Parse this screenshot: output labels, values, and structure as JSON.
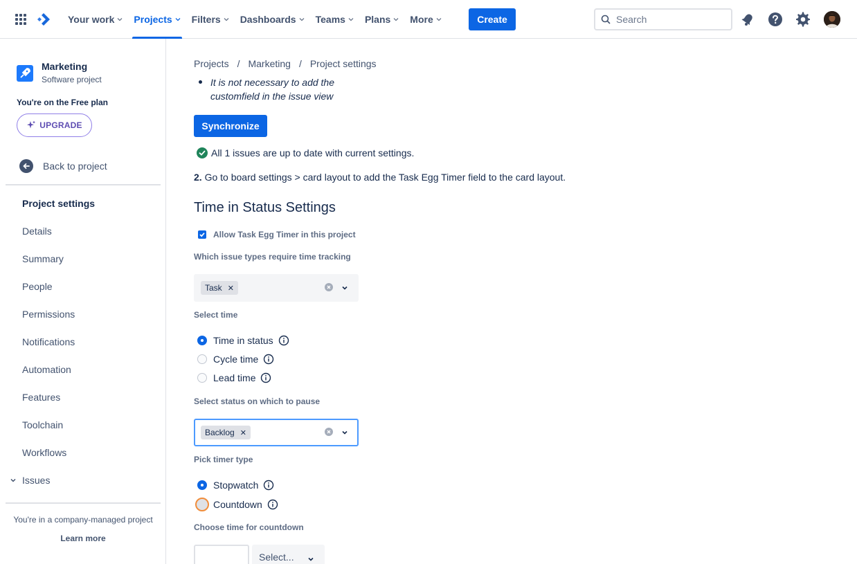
{
  "topnav": {
    "items": [
      {
        "label": "Your work"
      },
      {
        "label": "Projects",
        "active": true
      },
      {
        "label": "Filters"
      },
      {
        "label": "Dashboards"
      },
      {
        "label": "Teams"
      },
      {
        "label": "Plans"
      },
      {
        "label": "More"
      }
    ],
    "create_label": "Create",
    "search_placeholder": "Search",
    "icons": [
      "app-switcher-icon",
      "jira-logo-icon",
      "notifications-icon",
      "help-icon",
      "settings-icon",
      "user-avatar"
    ]
  },
  "sidebar": {
    "project_name": "Marketing",
    "project_type": "Software project",
    "plan_text": "You're on the Free plan",
    "upgrade_label": "UPGRADE",
    "back_label": "Back to project",
    "heading": "Project settings",
    "items": [
      "Details",
      "Summary",
      "People",
      "Permissions",
      "Notifications",
      "Automation",
      "Features",
      "Toolchain",
      "Workflows"
    ],
    "issues_label": "Issues",
    "company_text": "You're in a company-managed project",
    "learn_more": "Learn more"
  },
  "main": {
    "breadcrumb": [
      "Projects",
      "Marketing",
      "Project settings"
    ],
    "note": "It is not necessary to add the customfield in the issue view",
    "sync_label": "Synchronize",
    "uptodate_text": "All 1 issues are up to date with current settings.",
    "step2_num": "2.",
    "step2_text": " Go to board settings > card layout to add the Task Egg Timer field to the card layout.",
    "section_title": "Time in Status Settings",
    "allow_label": "Allow Task Egg Timer in this project",
    "allow_checked": true,
    "issue_types_label": "Which issue types require time tracking",
    "issue_types_selected": [
      "Task"
    ],
    "select_time_label": "Select time",
    "time_options": [
      {
        "label": "Time in status",
        "selected": true
      },
      {
        "label": "Cycle time",
        "selected": false
      },
      {
        "label": "Lead time",
        "selected": false
      }
    ],
    "pause_status_label": "Select status on which to pause",
    "pause_status_selected": [
      "Backlog"
    ],
    "timer_type_label": "Pick timer type",
    "timer_options": [
      {
        "label": "Stopwatch",
        "selected": true
      },
      {
        "label": "Countdown",
        "selected": false
      }
    ],
    "countdown_label": "Choose time for countdown",
    "countdown_value": "",
    "countdown_unit_placeholder": "Select..."
  },
  "colors": {
    "primary": "#0c66e4",
    "success": "#1f845a",
    "upgrade": "#5e4db2",
    "focus_ring": "#f18d3b"
  }
}
